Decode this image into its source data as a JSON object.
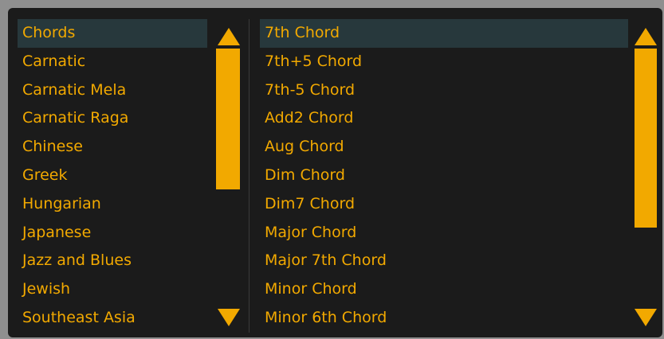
{
  "colors": {
    "accent": "#f2a900",
    "panel_bg": "#1b1b1b",
    "selected_bg": "#27383c",
    "outer_bg": "#8f8f8f"
  },
  "scale_categories": {
    "selected": "Chords",
    "items": [
      "Chords",
      "Carnatic",
      "Carnatic Mela",
      "Carnatic Raga",
      "Chinese",
      "Greek",
      "Hungarian",
      "Japanese",
      "Jazz and Blues",
      "Jewish",
      "Southeast Asia"
    ],
    "scroll_position": 0,
    "visible_fraction": 0.55
  },
  "scales": {
    "selected": "7th Chord",
    "items": [
      "7th Chord",
      "7th+5 Chord",
      "7th-5 Chord",
      "Add2 Chord",
      "Aug Chord",
      "Dim Chord",
      "Dim7 Chord",
      "Major Chord",
      "Major 7th Chord",
      "Minor Chord",
      "Minor 6th Chord"
    ],
    "scroll_position": 0,
    "visible_fraction": 0.7
  },
  "icons": {
    "scroll_up": "triangle-up-icon",
    "scroll_down": "triangle-down-icon"
  }
}
